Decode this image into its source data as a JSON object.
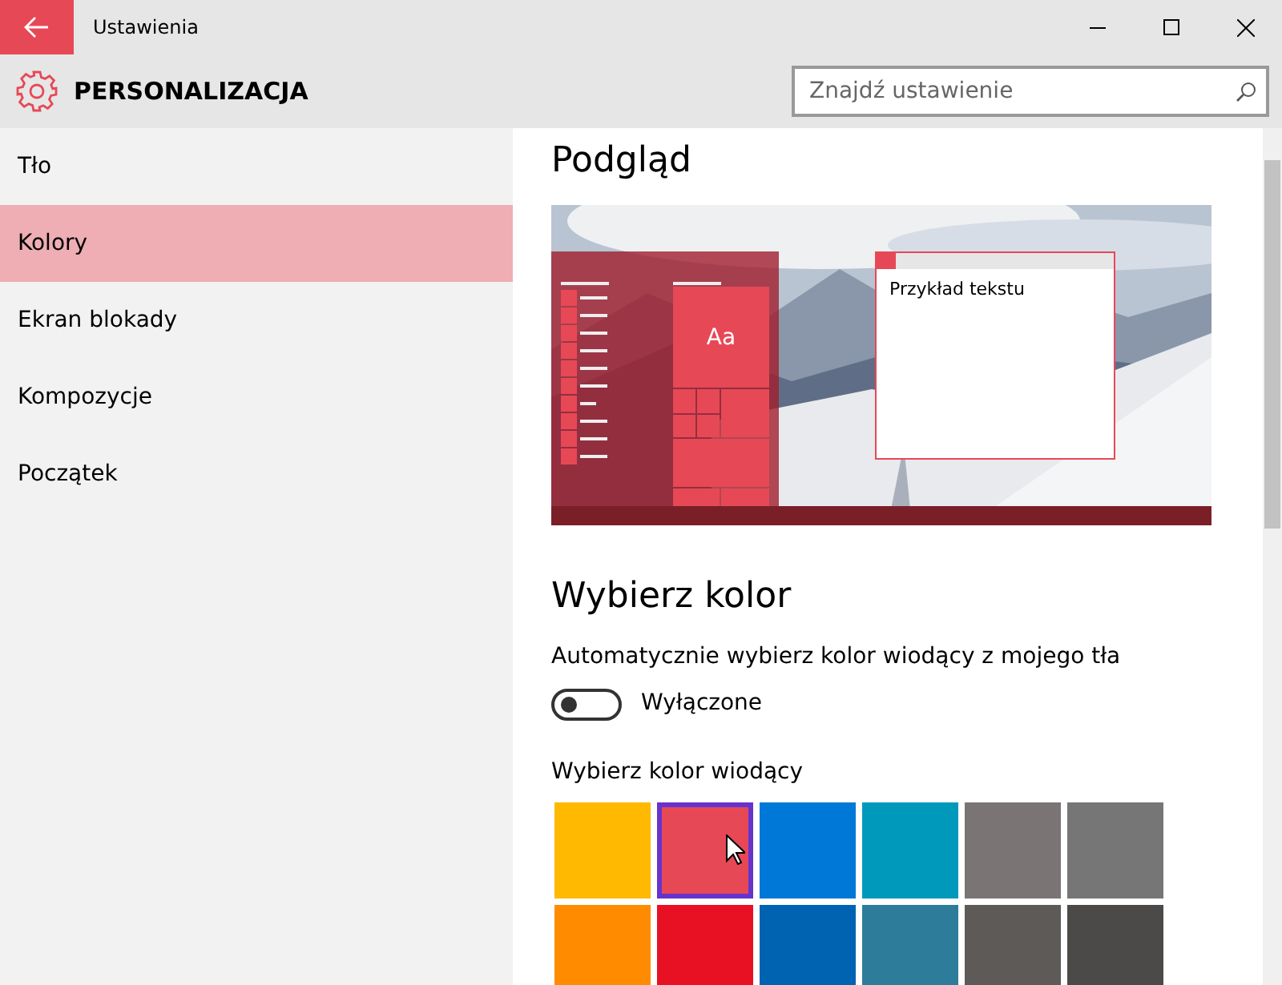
{
  "window": {
    "title": "Ustawienia"
  },
  "header": {
    "title": "PERSONALIZACJA",
    "search": {
      "placeholder": "Znajdź ustawienie"
    }
  },
  "sidebar": {
    "items": [
      {
        "label": "Tło",
        "selected": false
      },
      {
        "label": "Kolory",
        "selected": true
      },
      {
        "label": "Ekran blokady",
        "selected": false
      },
      {
        "label": "Kompozycje",
        "selected": false
      },
      {
        "label": "Początek",
        "selected": false
      }
    ]
  },
  "preview": {
    "heading": "Podgląd",
    "tile_text": "Aa",
    "sample_text": "Przykład tekstu"
  },
  "colors": {
    "heading": "Wybierz kolor",
    "auto_label": "Automatycznie wybierz kolor wiodący z mojego tła",
    "auto_toggle": {
      "on": false,
      "state_text": "Wyłączone"
    },
    "accent_label": "Wybierz kolor wiodący",
    "swatches": [
      {
        "color": "#ffb900",
        "selected": false
      },
      {
        "color": "#e74856",
        "selected": true
      },
      {
        "color": "#0078d7",
        "selected": false
      },
      {
        "color": "#0099bc",
        "selected": false
      },
      {
        "color": "#7a7574",
        "selected": false
      },
      {
        "color": "#767676",
        "selected": false
      },
      {
        "color": "#ff8c00",
        "selected": false
      },
      {
        "color": "#e81123",
        "selected": false
      },
      {
        "color": "#0063b1",
        "selected": false
      },
      {
        "color": "#2d7d9a",
        "selected": false
      },
      {
        "color": "#5d5a58",
        "selected": false
      },
      {
        "color": "#4c4a48",
        "selected": false
      }
    ]
  }
}
